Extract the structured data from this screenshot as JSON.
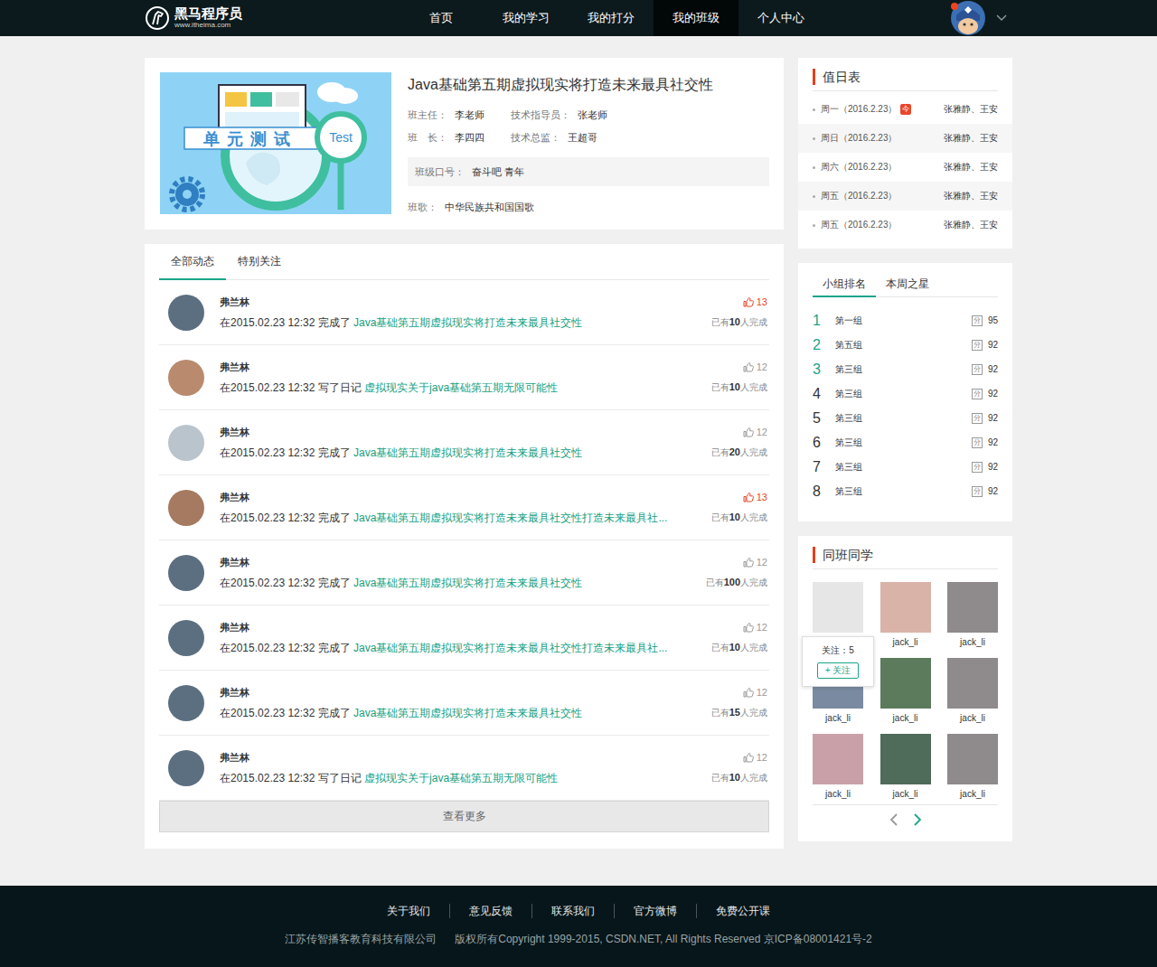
{
  "header": {
    "logo": {
      "name": "黑马程序员",
      "url": "www.itheima.com"
    },
    "nav": [
      {
        "label": "首页",
        "selected": false
      },
      {
        "label": "我的学习",
        "selected": false
      },
      {
        "label": "我的打分",
        "selected": false
      },
      {
        "label": "我的班级",
        "selected": true
      },
      {
        "label": "个人中心",
        "selected": false
      }
    ],
    "user": {
      "has_notification": true
    }
  },
  "class_info": {
    "banner": {
      "title": "单元测试",
      "tag": "Test"
    },
    "title": "Java基础第五期虚拟现实将打造未来最具社交性",
    "fields": [
      {
        "label": "班主任：",
        "value": "李老师"
      },
      {
        "label": "技术指导员：",
        "value": "张老师"
      },
      {
        "label": "班　长：",
        "value": "李四四"
      },
      {
        "label": "技术总监：",
        "value": "王超哥"
      }
    ],
    "slogan": {
      "label": "班级口号：",
      "value": "奋斗吧 青年"
    },
    "song": {
      "label": "班歌：",
      "value": "中华民族共和国国歌"
    }
  },
  "feed": {
    "tabs": [
      {
        "label": "全部动态",
        "selected": true
      },
      {
        "label": "特别关注",
        "selected": false
      }
    ],
    "items": [
      {
        "name": "弗兰林",
        "text": "在2015.02.23 12:32 完成了",
        "link": "Java基础第五期虚拟现实将打造未来最具社交性",
        "likes": "13",
        "liked": true,
        "done_pre": "已有",
        "done_count": "10",
        "done_post": "人完成",
        "color": "#5c6f80"
      },
      {
        "name": "弗兰林",
        "text": "在2015.02.23 12:32 写了日记",
        "link": "虚拟现实关于java基础第五期无限可能性",
        "likes": "12",
        "liked": false,
        "done_pre": "已有",
        "done_count": "10",
        "done_post": "人完成",
        "color": "#b98a6e"
      },
      {
        "name": "弗兰林",
        "text": "在2015.02.23 12:32 完成了",
        "link": "Java基础第五期虚拟现实将打造未来最具社交性",
        "likes": "12",
        "liked": false,
        "done_pre": "已有",
        "done_count": "20",
        "done_post": "人完成",
        "color": "#b9c4cc"
      },
      {
        "name": "弗兰林",
        "text": "在2015.02.23 12:32 完成了",
        "link": "Java基础第五期虚拟现实将打造未来最具社交性打造未来最具社...",
        "likes": "13",
        "liked": true,
        "done_pre": "已有",
        "done_count": "10",
        "done_post": "人完成",
        "color": "#a57a60"
      },
      {
        "name": "弗兰林",
        "text": "在2015.02.23 12:32 完成了",
        "link": "Java基础第五期虚拟现实将打造未来最具社交性",
        "likes": "12",
        "liked": false,
        "done_pre": "已有",
        "done_count": "100",
        "done_post": "人完成",
        "color": "#5c6f80"
      },
      {
        "name": "弗兰林",
        "text": "在2015.02.23 12:32 完成了",
        "link": "Java基础第五期虚拟现实将打造未来最具社交性打造未来最具社...",
        "likes": "12",
        "liked": false,
        "done_pre": "已有",
        "done_count": "10",
        "done_post": "人完成",
        "color": "#5c6f80"
      },
      {
        "name": "弗兰林",
        "text": "在2015.02.23 12:32 完成了",
        "link": "Java基础第五期虚拟现实将打造未来最具社交性",
        "likes": "12",
        "liked": false,
        "done_pre": "已有",
        "done_count": "15",
        "done_post": "人完成",
        "color": "#5c6f80"
      },
      {
        "name": "弗兰林",
        "text": "在2015.02.23 12:32 写了日记",
        "link": "虚拟现实关于java基础第五期无限可能性",
        "likes": "12",
        "liked": false,
        "done_pre": "已有",
        "done_count": "10",
        "done_post": "人完成",
        "color": "#5c6f80"
      }
    ],
    "load_more": "查看更多"
  },
  "duty": {
    "title": "值日表",
    "today_badge": "今",
    "rows": [
      {
        "day": "周一（2016.2.23）",
        "today": true,
        "names": "张雅静、王安"
      },
      {
        "day": "周日（2016.2.23）",
        "today": false,
        "names": "张雅静、王安"
      },
      {
        "day": "周六（2016.2.23）",
        "today": false,
        "names": "张雅静、王安"
      },
      {
        "day": "周五（2016.2.23）",
        "today": false,
        "names": "张雅静、王安"
      },
      {
        "day": "周五（2016.2.23）",
        "today": false,
        "names": "张雅静、王安"
      }
    ]
  },
  "ranking": {
    "tabs": [
      {
        "label": "小组排名",
        "selected": true
      },
      {
        "label": "本周之星",
        "selected": false
      }
    ],
    "score_icon": "分",
    "rows": [
      {
        "rank": "1",
        "name": "第一组",
        "score": "95",
        "highlight": true
      },
      {
        "rank": "2",
        "name": "第五组",
        "score": "92",
        "highlight": true
      },
      {
        "rank": "3",
        "name": "第三组",
        "score": "92",
        "highlight": true
      },
      {
        "rank": "4",
        "name": "第三组",
        "score": "92",
        "highlight": false
      },
      {
        "rank": "5",
        "name": "第三组",
        "score": "92",
        "highlight": false
      },
      {
        "rank": "6",
        "name": "第三组",
        "score": "92",
        "highlight": false
      },
      {
        "rank": "7",
        "name": "第三组",
        "score": "92",
        "highlight": false
      },
      {
        "rank": "8",
        "name": "第三组",
        "score": "92",
        "highlight": false
      }
    ]
  },
  "classmates": {
    "title": "同班同学",
    "tooltip": {
      "label": "关注：5",
      "button": "+ 关注"
    },
    "students": [
      {
        "hovered": true,
        "color": "#e6e6e6"
      },
      {
        "name": "jack_li",
        "hovered": false,
        "color": "#d9b3a8"
      },
      {
        "name": "jack_li",
        "hovered": false,
        "color": "#8f8a8c"
      },
      {
        "name": "jack_li",
        "hovered": false,
        "color": "#7a8aa0"
      },
      {
        "name": "jack_li",
        "hovered": false,
        "color": "#5c7a5c"
      },
      {
        "name": "jack_li",
        "hovered": false,
        "color": "#8f8a8c"
      },
      {
        "name": "jack_li",
        "hovered": false,
        "color": "#c9a0a8"
      },
      {
        "name": "jack_li",
        "hovered": false,
        "color": "#4f6b5a"
      },
      {
        "name": "jack_li",
        "hovered": false,
        "color": "#8f8a8c"
      }
    ],
    "pager": {
      "prev_enabled": false,
      "next_enabled": true
    }
  },
  "footer": {
    "links": [
      "关于我们",
      "意见反馈",
      "联系我们",
      "官方微博",
      "免费公开课"
    ],
    "company": "江苏传智播客教育科技有限公司",
    "copyright": "版权所有Copyright 1999-2015, CSDN.NET, All Rights Reserved 京ICP备08001421号-2"
  }
}
